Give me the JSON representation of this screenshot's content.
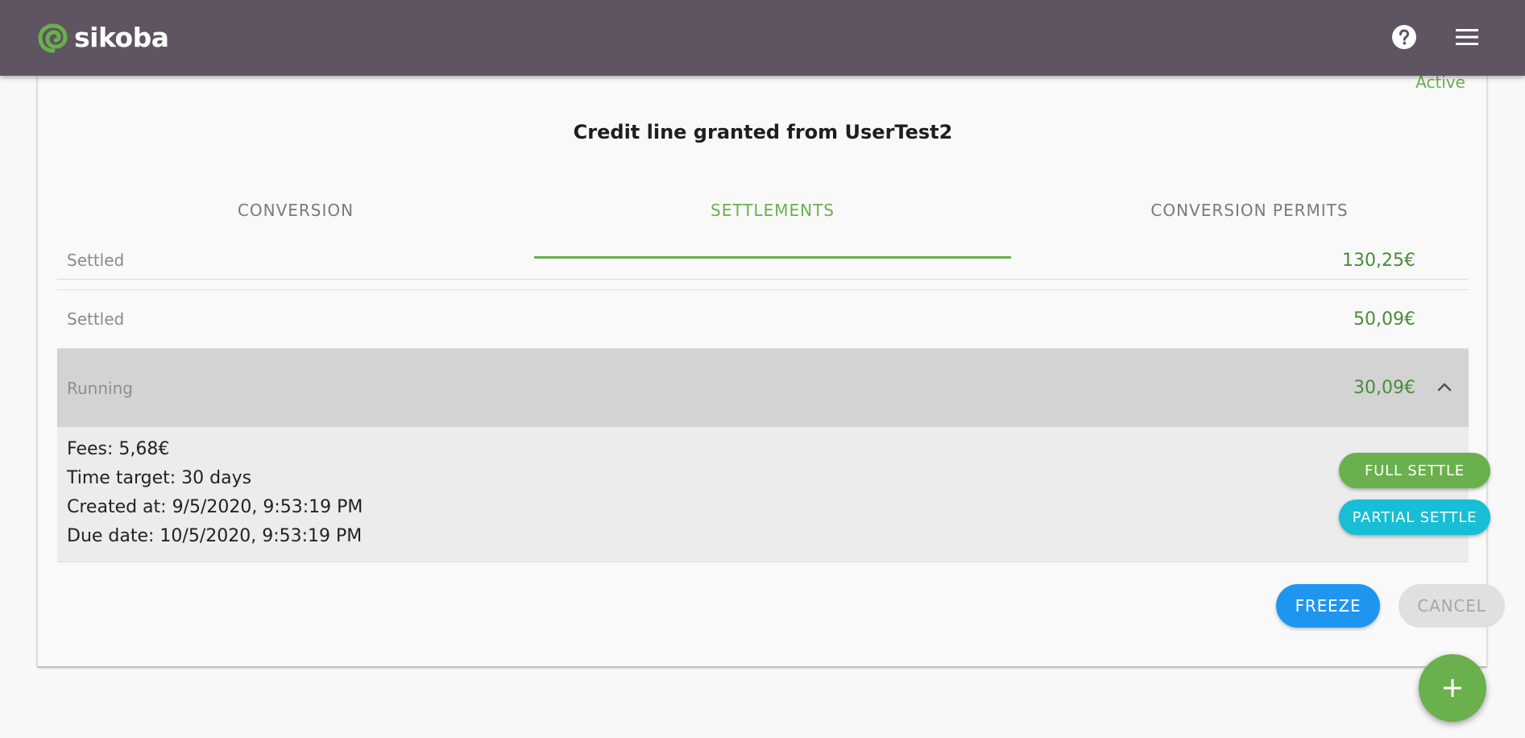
{
  "header": {
    "brand": "sikoba",
    "help_icon": "help-circle-icon",
    "menu_icon": "hamburger-menu-icon",
    "colors": {
      "bar": "#5e5462",
      "logo_green": "#6ab04c"
    }
  },
  "card": {
    "status": "Active",
    "title": "Credit line granted from UserTest2"
  },
  "tabs": [
    {
      "label": "CONVERSION",
      "active": false
    },
    {
      "label": "SETTLEMENTS",
      "active": true
    },
    {
      "label": "CONVERSION PERMITS",
      "active": false
    }
  ],
  "settlements": [
    {
      "status": "Settled",
      "amount": "130,25€"
    },
    {
      "status": "Settled",
      "amount": "50,09€"
    },
    {
      "status": "Running",
      "amount": "30,09€",
      "expanded": true,
      "details": [
        "Fees: 5,68€",
        "Time target: 30 days",
        "Created at: 9/5/2020, 9:53:19 PM",
        "Due date: 10/5/2020, 9:53:19 PM"
      ],
      "actions": {
        "full_settle": "FULL SETTLE",
        "partial_settle": "PARTIAL SETTLE"
      }
    }
  ],
  "footer_actions": {
    "freeze": "FREEZE",
    "cancel": "CANCEL"
  },
  "fab_icon": "plus-icon",
  "colors": {
    "accent_green": "#6ab04c",
    "amount_green": "#4a8b3a",
    "freeze_blue": "#1e96f0",
    "partial_cyan": "#17bed6",
    "disabled_gray": "#e0e0e0"
  }
}
